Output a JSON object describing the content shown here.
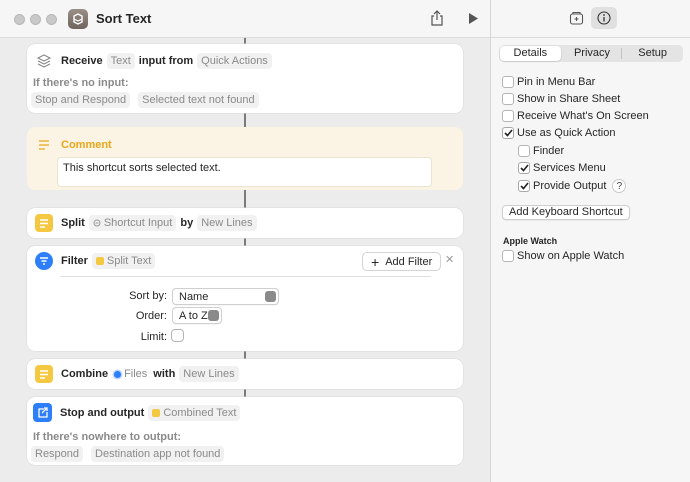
{
  "window": {
    "title": "Sort Text"
  },
  "actions": {
    "receive": {
      "label": "Receive",
      "type_token": "Text",
      "input_from": "input from",
      "source_token": "Quick Actions",
      "no_input_label": "If there's no input:",
      "no_input_action": "Stop and Respond",
      "no_input_result": "Selected text not found"
    },
    "comment": {
      "label": "Comment",
      "text": "This shortcut sorts selected text."
    },
    "split": {
      "label": "Split",
      "input_token": "Shortcut Input",
      "by": "by",
      "separator_token": "New Lines"
    },
    "filter": {
      "label": "Filter",
      "input_token": "Split Text",
      "add_filter": "Add Filter",
      "sort_by_label": "Sort by:",
      "sort_by_value": "Name",
      "order_label": "Order:",
      "order_value": "A to Z",
      "limit_label": "Limit:"
    },
    "combine": {
      "label": "Combine",
      "input_token": "Files",
      "with": "with",
      "separator_token": "New Lines"
    },
    "stop": {
      "label": "Stop and output",
      "input_token": "Combined Text",
      "nowhere_label": "If there's nowhere to output:",
      "nowhere_action": "Respond",
      "nowhere_result": "Destination app not found"
    }
  },
  "sidebar": {
    "tabs": [
      {
        "label": "Details",
        "active": true
      },
      {
        "label": "Privacy",
        "active": false
      },
      {
        "label": "Setup",
        "active": false
      }
    ],
    "options": [
      {
        "label": "Pin in Menu Bar",
        "checked": false
      },
      {
        "label": "Show in Share Sheet",
        "checked": false
      },
      {
        "label": "Receive What's On Screen",
        "checked": false
      },
      {
        "label": "Use as Quick Action",
        "checked": true
      },
      {
        "label": "Finder",
        "checked": false
      },
      {
        "label": "Services Menu",
        "checked": true
      },
      {
        "label": "Provide Output",
        "checked": true
      }
    ],
    "help": "?",
    "keyboard_button": "Add Keyboard Shortcut",
    "apple_watch_title": "Apple Watch",
    "apple_watch_option": {
      "label": "Show on Apple Watch",
      "checked": false
    }
  },
  "colors": {
    "accent_blue": "#2d7ff9",
    "action_yellow": "#f5c842",
    "comment_bg": "#fbf4e4",
    "comment_title": "#e8a619"
  }
}
